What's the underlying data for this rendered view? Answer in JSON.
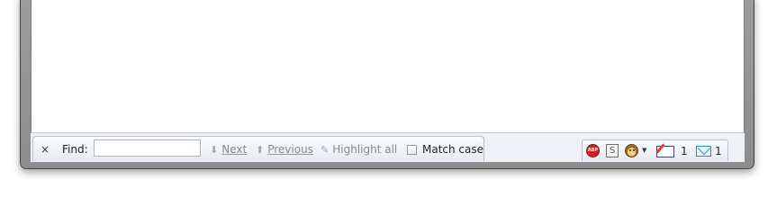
{
  "findbar": {
    "close_glyph": "×",
    "find_label": "Find:",
    "search_value": "",
    "next_label": "Next",
    "previous_label": "Previous",
    "highlight_label": "Highlight all",
    "match_case_label": "Match case",
    "match_case_checked": false
  },
  "statusbar": {
    "adblock_text": "ABP",
    "s_icon_text": "S",
    "mail_count_1": "1",
    "mail_count_2": "1"
  },
  "colors": {
    "frame": "#8d8d8d",
    "content_bg": "#ffffff",
    "bar_bg": "#eef1f5",
    "disabled_text": "#8a8a8a",
    "adblock_red": "#d6201f"
  }
}
